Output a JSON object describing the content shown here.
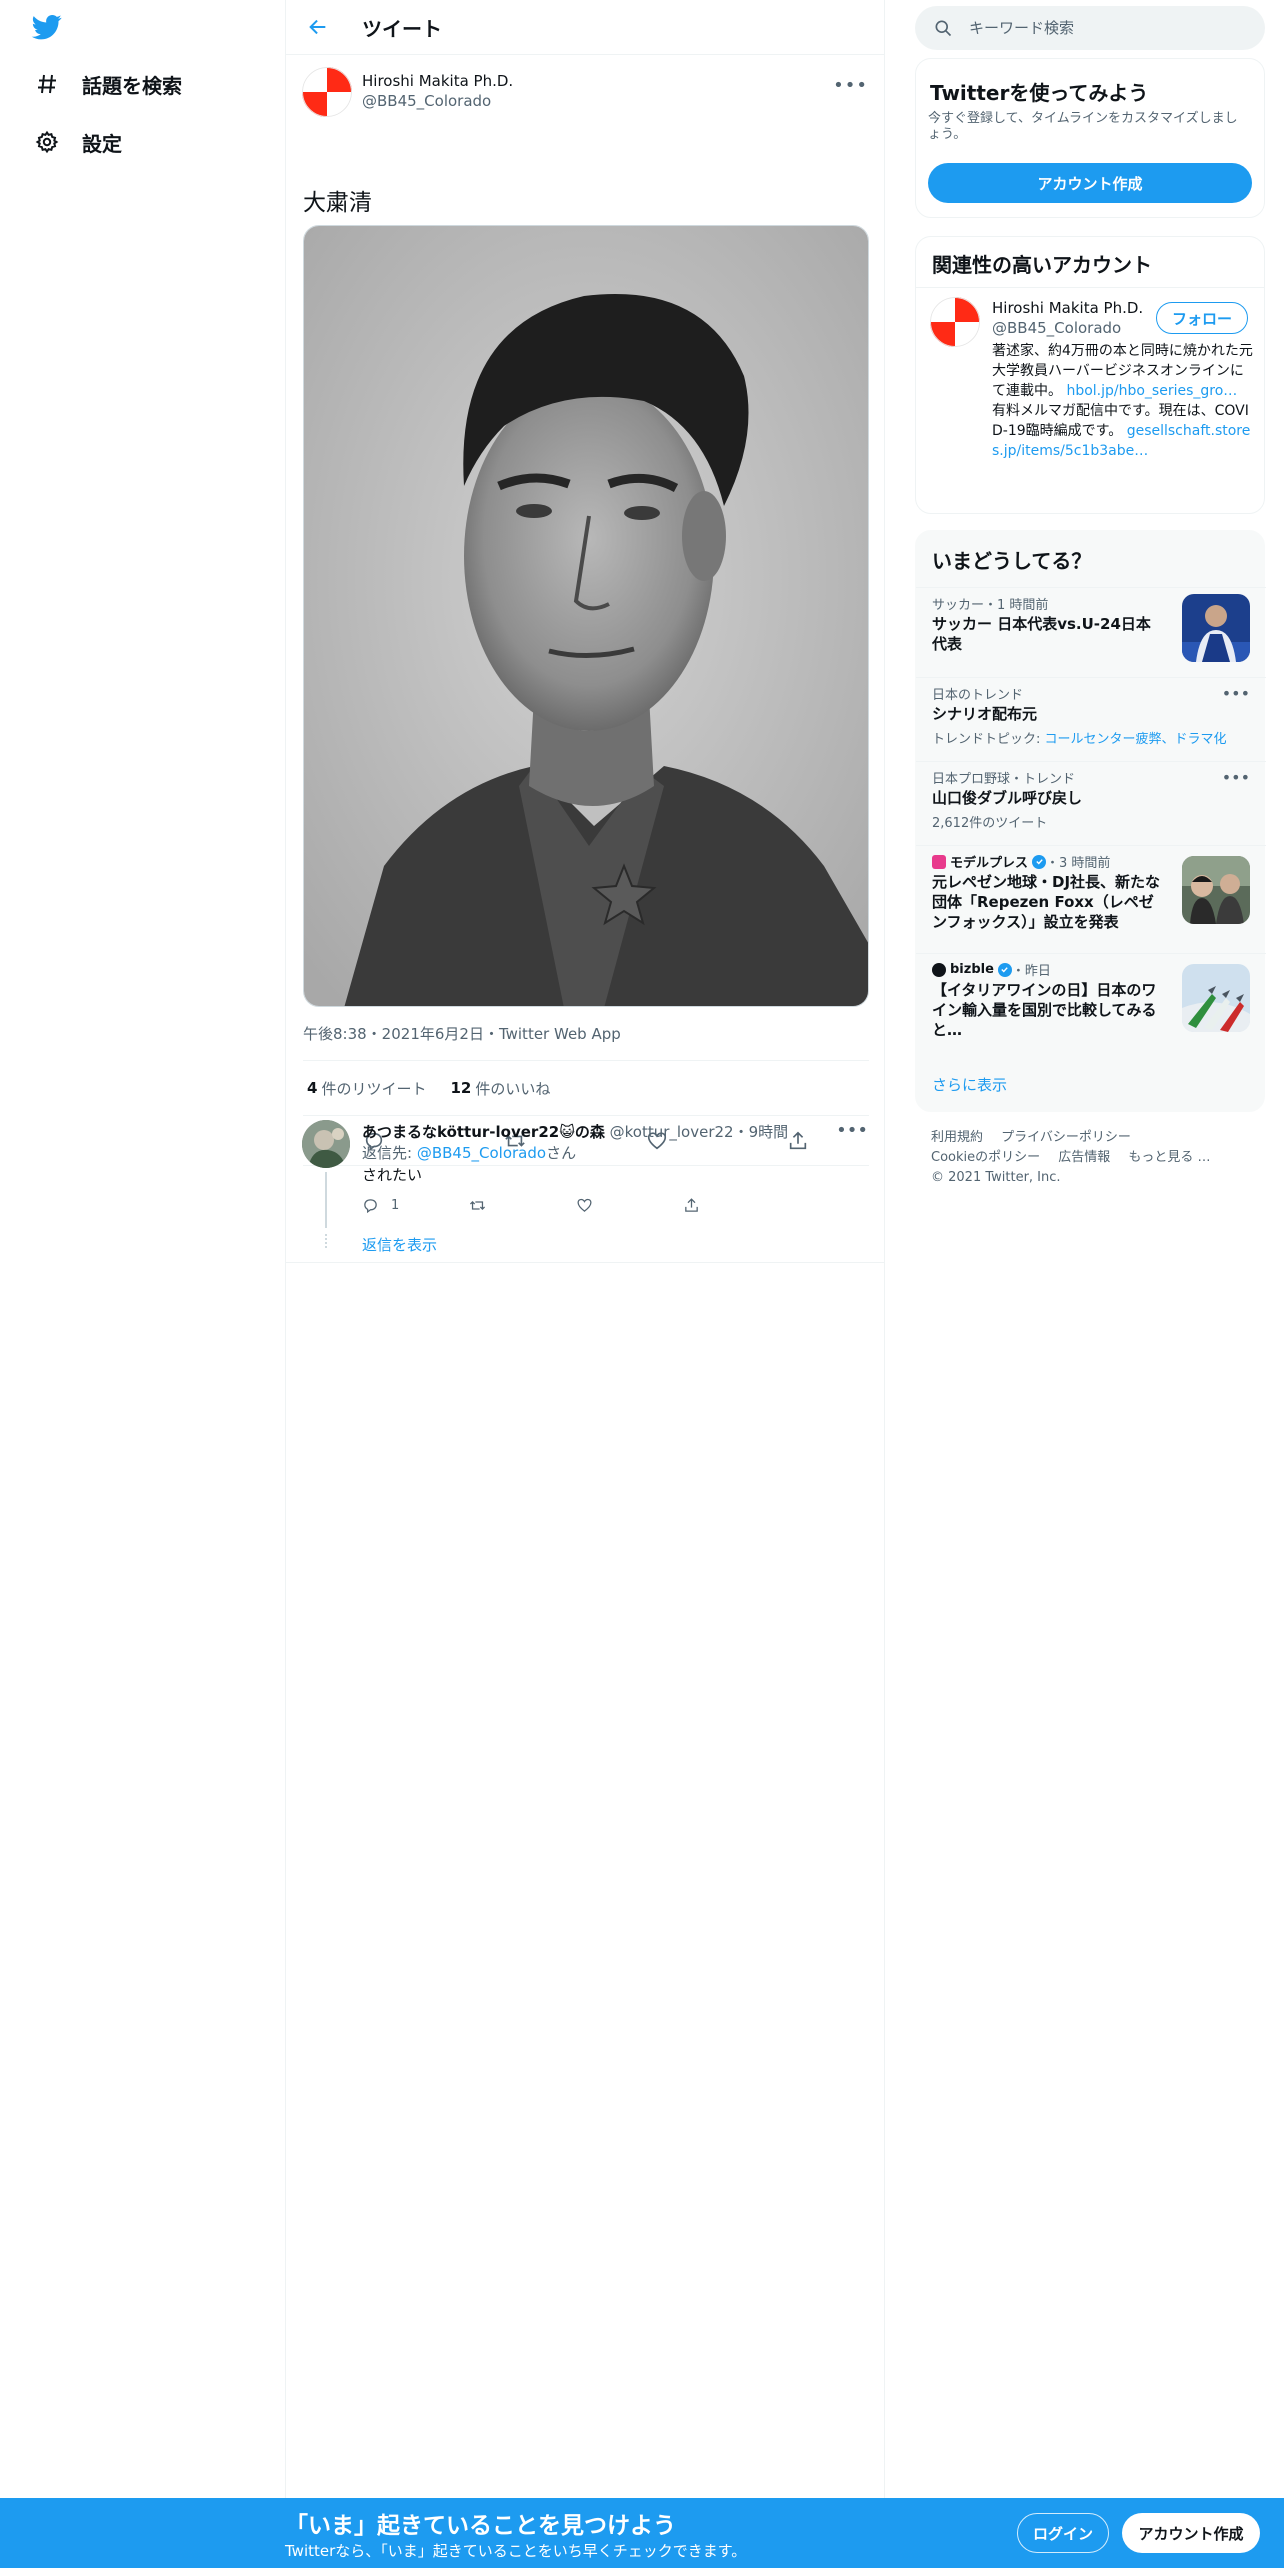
{
  "nav": {
    "items": [
      {
        "label": "話題を検索",
        "icon": "hashtag-icon"
      },
      {
        "label": "設定",
        "icon": "gear-icon"
      }
    ]
  },
  "header": {
    "title": "ツイート"
  },
  "tweet": {
    "author_name": "Hiroshi Makita Ph.D.",
    "author_handle": "@BB45_Colorado",
    "text": "大粛清",
    "meta": "午後8:38・2021年6月2日・Twitter Web App",
    "retweets": "4",
    "retweets_label": "件のリツイート",
    "likes": "12",
    "likes_label": "件のいいね"
  },
  "reply": {
    "name": "あつまるなköttur-lover22😺の森",
    "handle_time": "@kottur_lover22・9時間",
    "reply_to_prefix": "返信先:",
    "reply_to_handle": "@BB45_Colorado",
    "reply_to_suffix": "さん",
    "text": "されたい",
    "reply_count": "1",
    "show_replies": "返信を表示"
  },
  "search": {
    "placeholder": "キーワード検索"
  },
  "signup_card": {
    "title": "Twitterを使ってみよう",
    "desc": "今すぐ登録して、タイムラインをカスタマイズしましょう。",
    "button": "アカウント作成"
  },
  "related": {
    "title": "関連性の高いアカウント",
    "name": "Hiroshi Makita Ph.D.",
    "handle": "@BB45_Colorado",
    "follow": "フォロー",
    "bio_1": "著述家、約4万冊の本と同時に焼かれた元大学教員ハーバービジネスオンラインにて連載中。",
    "bio_link_1": "hbol.jp/hbo_series_gro…",
    "bio_2": " 有料メルマガ配信中です。現在は、COVID-19臨時編成です。",
    "bio_link_2": "gesellschaft.stores.jp/items/5c1b3abe…"
  },
  "trends": {
    "title": "いまどうしてる？",
    "items": [
      {
        "meta": "サッカー・1 時間前",
        "title": "サッカー 日本代表vs.U-24日本代表"
      },
      {
        "meta": "日本のトレンド",
        "title": "シナリオ配布元",
        "sub_prefix": "トレンドトピック:",
        "sub_links": "コールセンター疲弊、ドラマ化"
      },
      {
        "meta": "日本プロ野球・トレンド",
        "title": "山口俊ダブル呼び戻し",
        "sub": "2,612件のツイート"
      },
      {
        "source": "モデルプレス",
        "time": "・3 時間前",
        "title": "元レペゼン地球・DJ社長、新たな団体「Repezen Foxx（レペゼンフォックス）」設立を発表"
      },
      {
        "source": "bizble",
        "time": "・昨日",
        "title": "【イタリアワインの日】日本のワイン輸入量を国別で比較してみると…"
      }
    ],
    "show_more": "さらに表示"
  },
  "footer": {
    "links": [
      "利用規約",
      "プライバシーポリシー",
      "Cookieのポリシー",
      "広告情報",
      "もっと見る …"
    ],
    "copyright": "© 2021 Twitter, Inc."
  },
  "bottom_bar": {
    "title": "「いま」起きていることを見つけよう",
    "subtitle": "Twitterなら、「いま」起きていることをいち早くチェックできます。",
    "login": "ログイン",
    "signup": "アカウント作成"
  },
  "colors": {
    "brand": "#1d9bf0",
    "avatar_red": "#ff2a15",
    "text_secondary": "#536471"
  }
}
